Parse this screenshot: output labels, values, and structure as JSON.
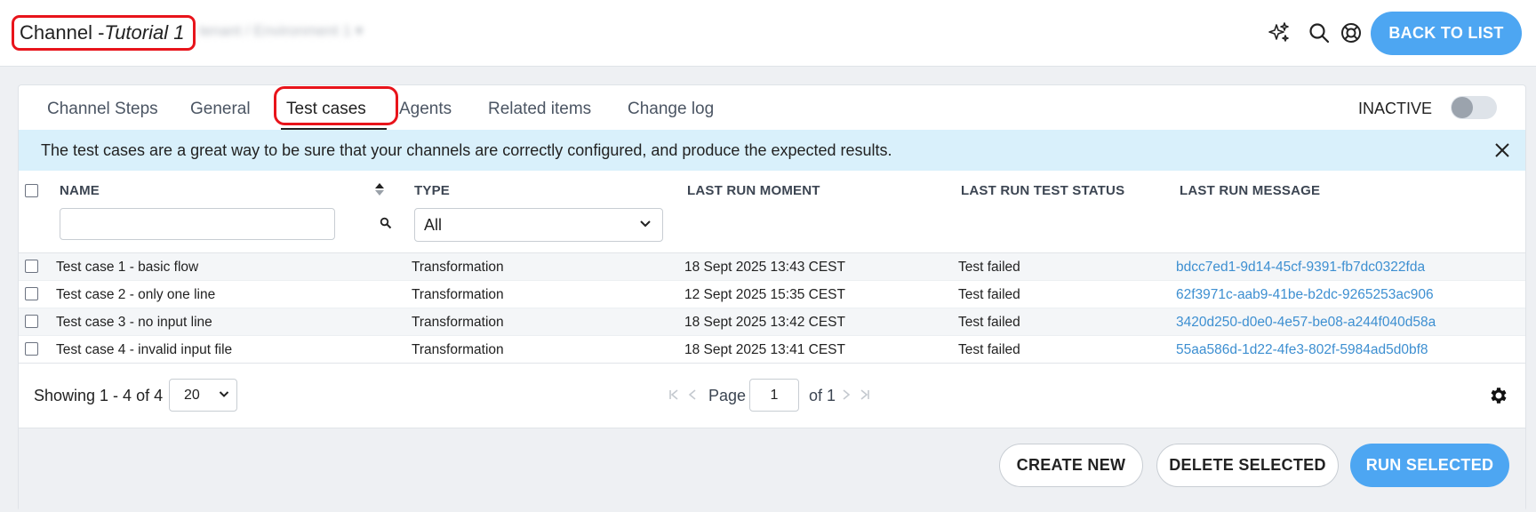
{
  "header": {
    "title_prefix": "Channel - ",
    "title_name": "Tutorial 1",
    "breadcrumb": "tenant / Environment 1 ▾",
    "back_label": "BACK TO LIST"
  },
  "tabs": [
    "Channel Steps",
    "General",
    "Test cases",
    "Agents",
    "Related items",
    "Change log"
  ],
  "active_tab": "Test cases",
  "status": {
    "label": "INACTIVE",
    "enabled": false
  },
  "info_banner": "The test cases are a great way to be sure that your channels are correctly configured, and produce the expected results.",
  "table": {
    "columns": [
      "NAME",
      "TYPE",
      "LAST RUN MOMENT",
      "LAST RUN TEST STATUS",
      "LAST RUN MESSAGE"
    ],
    "filters": {
      "name_value": "",
      "type_value": "All"
    },
    "rows": [
      {
        "name": "Test case 1 - basic flow",
        "type": "Transformation",
        "moment": "18 Sept 2025 13:43 CEST",
        "status": "Test failed",
        "message": "bdcc7ed1-9d14-45cf-9391-fb7dc0322fda"
      },
      {
        "name": "Test case 2 - only one line",
        "type": "Transformation",
        "moment": "12 Sept 2025 15:35 CEST",
        "status": "Test failed",
        "message": "62f3971c-aab9-41be-b2dc-9265253ac906"
      },
      {
        "name": "Test case 3 - no input line",
        "type": "Transformation",
        "moment": "18 Sept 2025 13:42 CEST",
        "status": "Test failed",
        "message": "3420d250-d0e0-4e57-be08-a244f040d58a"
      },
      {
        "name": "Test case 4 - invalid input file",
        "type": "Transformation",
        "moment": "18 Sept 2025 13:41 CEST",
        "status": "Test failed",
        "message": "55aa586d-1d22-4fe3-802f-5984ad5d0bf8"
      }
    ]
  },
  "pagination": {
    "showing": "Showing 1 - 4 of 4",
    "page_size": "20",
    "page_label": "Page",
    "page": "1",
    "of_label": "of 1"
  },
  "footer": {
    "create_label": "CREATE NEW",
    "delete_label": "DELETE SELECTED",
    "run_label": "RUN SELECTED"
  },
  "colors": {
    "accent": "#4da6f2",
    "highlight": "#e8141b",
    "link": "#3d8fd1",
    "banner": "#d9f0fb"
  }
}
